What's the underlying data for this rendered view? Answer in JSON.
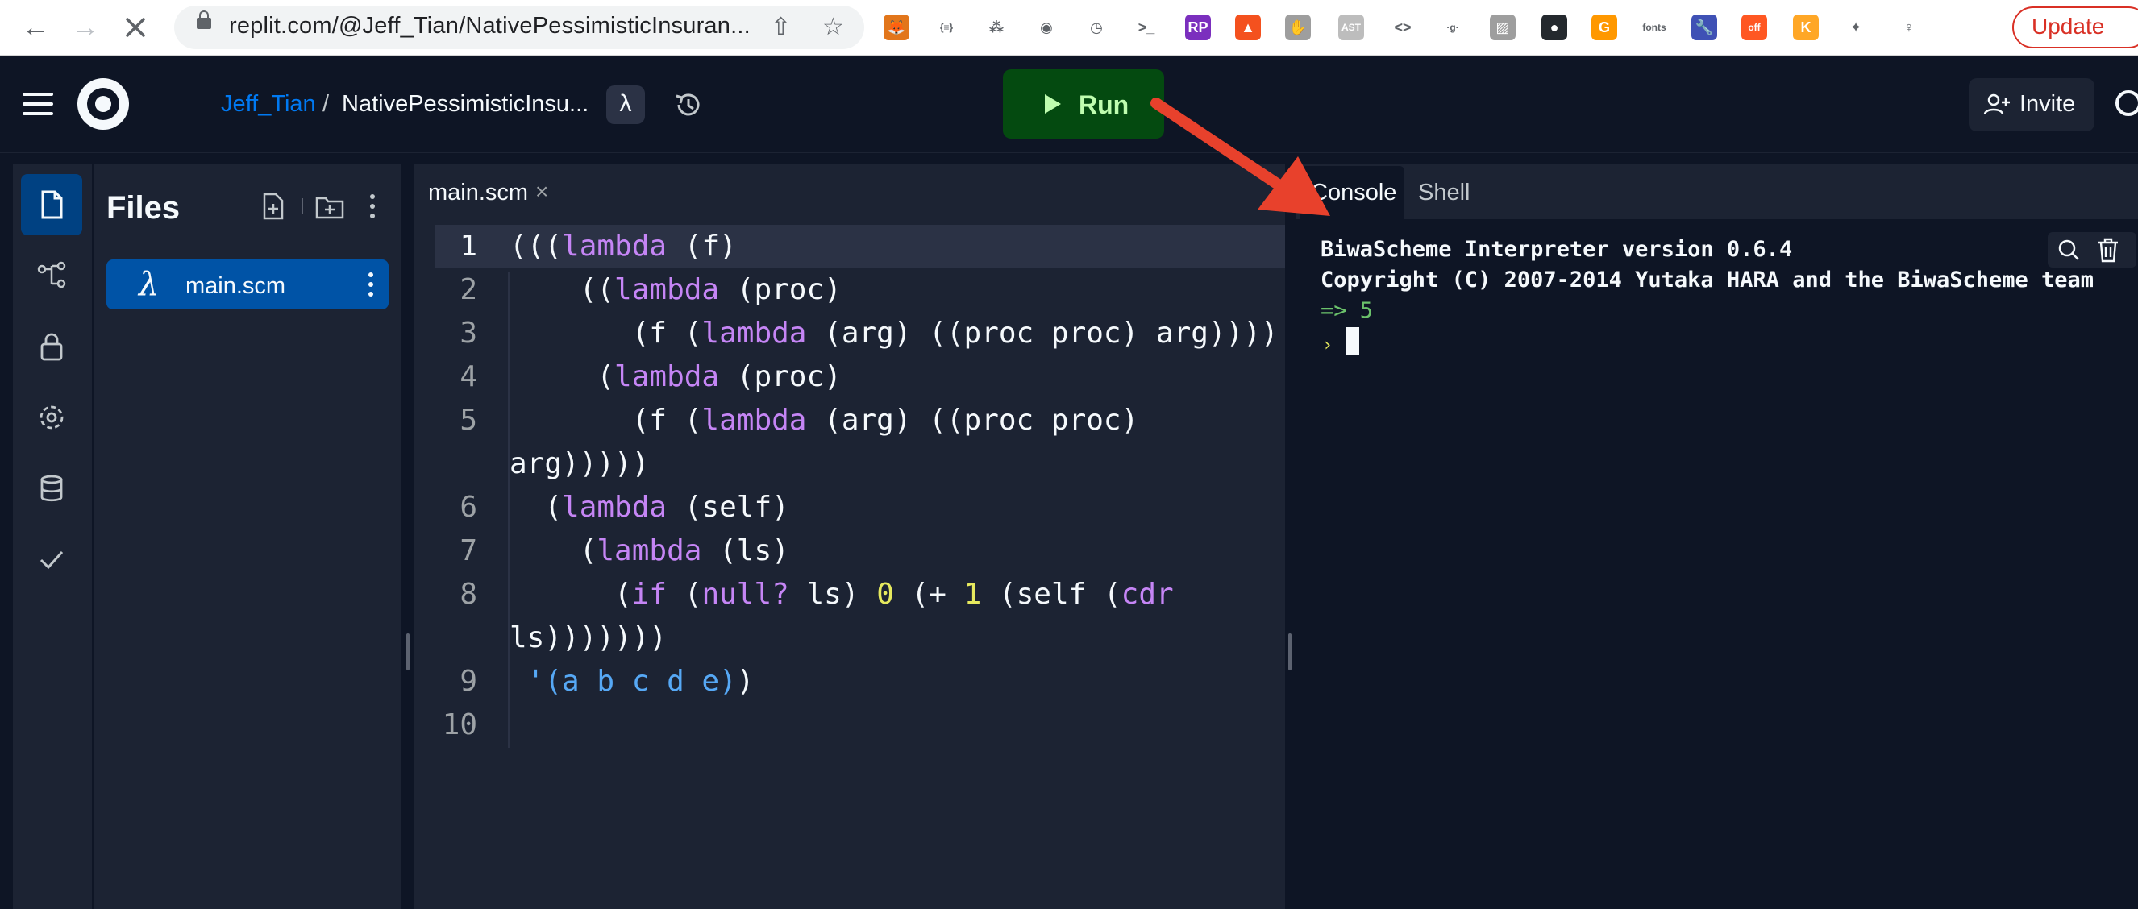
{
  "browser": {
    "url": "replit.com/@Jeff_Tian/NativePessimisticInsuran...",
    "update_label": "Update",
    "extensions": [
      {
        "name": "metamask-icon",
        "color": "#e2761b",
        "glyph": "🦊"
      },
      {
        "name": "json-icon",
        "color": "#ffffff",
        "glyph": "{≡}"
      },
      {
        "name": "network-icon",
        "color": "#ffffff",
        "glyph": "⁂"
      },
      {
        "name": "camera-icon",
        "color": "#ffffff",
        "glyph": "◉"
      },
      {
        "name": "clock-icon",
        "color": "#ffffff",
        "glyph": "◷"
      },
      {
        "name": "terminal-icon",
        "color": "#ffffff",
        "glyph": ">_"
      },
      {
        "name": "rp-icon",
        "color": "#7b2fbe",
        "glyph": "RP"
      },
      {
        "name": "lighthouse-icon",
        "color": "#f4511e",
        "glyph": "▲"
      },
      {
        "name": "gesture-icon",
        "color": "#9e9e9e",
        "glyph": "✋"
      },
      {
        "name": "ast-icon",
        "color": "#bdbdbd",
        "glyph": "AST"
      },
      {
        "name": "code-icon",
        "color": "#ffffff",
        "glyph": "<>"
      },
      {
        "name": "google-icon",
        "color": "#ffffff",
        "glyph": "·g·"
      },
      {
        "name": "image-icon",
        "color": "#9e9e9e",
        "glyph": "▨"
      },
      {
        "name": "github-icon",
        "color": "#24292e",
        "glyph": "●"
      },
      {
        "name": "grammarly-icon",
        "color": "#ff9800",
        "glyph": "G"
      },
      {
        "name": "fonts-icon",
        "color": "#ffffff",
        "glyph": "fonts"
      },
      {
        "name": "wrench-icon",
        "color": "#3f51b5",
        "glyph": "🔧"
      },
      {
        "name": "off-icon",
        "color": "#ff5722",
        "glyph": "off"
      },
      {
        "name": "k-icon",
        "color": "#ffa726",
        "glyph": "K"
      },
      {
        "name": "puzzle-icon",
        "color": "#ffffff",
        "glyph": "✦"
      },
      {
        "name": "pin-icon",
        "color": "#ffffff",
        "glyph": "♀"
      }
    ]
  },
  "header": {
    "user": "Jeff_Tian",
    "separator": "/",
    "repl_name": "NativePessimisticInsu...",
    "language_badge": "λ",
    "run_label": "Run",
    "invite_label": "Invite"
  },
  "files": {
    "title": "Files",
    "items": [
      {
        "icon": "λ",
        "name": "main.scm"
      }
    ]
  },
  "editor": {
    "tab_label": "main.scm",
    "tab_close": "×",
    "line_numbers": [
      "1",
      "2",
      "3",
      "4",
      "5",
      "",
      "6",
      "7",
      "8",
      "",
      "9",
      "10"
    ]
  },
  "console": {
    "tabs": [
      "Console",
      "Shell"
    ],
    "lines": [
      "BiwaScheme Interpreter version 0.6.4",
      "Copyright (C) 2007-2014 Yutaka HARA and the BiwaScheme team"
    ],
    "result": "=> 5",
    "prompt": "›"
  },
  "colors": {
    "accent": "#0079f2",
    "run_bg": "#044a10",
    "run_fg": "#bffdaf",
    "keyword": "#c585f5",
    "number": "#e6e95e",
    "quote": "#56a8f5",
    "annotation_arrow": "#e8412c"
  }
}
